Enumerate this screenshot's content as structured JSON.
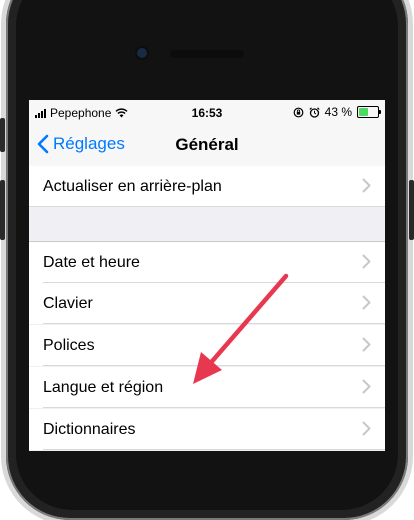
{
  "status_bar": {
    "carrier": "Pepephone",
    "time": "16:53",
    "battery_percent": "43 %",
    "battery_level": 0.43
  },
  "nav": {
    "back_label": "Réglages",
    "title": "Général"
  },
  "settings": {
    "items": [
      {
        "label": "Actualiser en arrière-plan"
      },
      {
        "label": "Date et heure"
      },
      {
        "label": "Clavier"
      },
      {
        "label": "Polices"
      },
      {
        "label": "Langue et région"
      },
      {
        "label": "Dictionnaires"
      }
    ]
  },
  "colors": {
    "accent": "#007aff",
    "annotation_arrow": "#e8384f",
    "battery": "#4cd964"
  }
}
